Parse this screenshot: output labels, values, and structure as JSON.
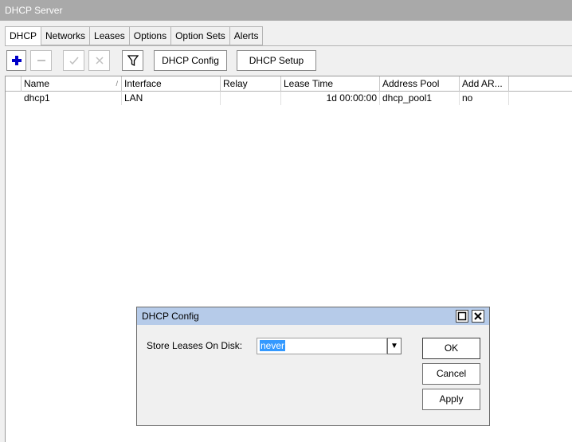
{
  "window": {
    "title": "DHCP Server"
  },
  "tabs": [
    {
      "label": "DHCP",
      "active": true
    },
    {
      "label": "Networks"
    },
    {
      "label": "Leases"
    },
    {
      "label": "Options"
    },
    {
      "label": "Option Sets"
    },
    {
      "label": "Alerts"
    }
  ],
  "toolbar": {
    "add_icon": "plus-icon",
    "remove_icon": "minus-icon",
    "enable_icon": "check-icon",
    "disable_icon": "cross-icon",
    "filter_icon": "filter-icon",
    "dhcp_config_label": "DHCP Config",
    "dhcp_setup_label": "DHCP Setup",
    "accent_color": "#0000c8"
  },
  "table": {
    "columns": [
      "Name",
      "Interface",
      "Relay",
      "Lease Time",
      "Address Pool",
      "Add AR..."
    ],
    "rows": [
      {
        "name": "dhcp1",
        "interface": "LAN",
        "relay": "",
        "lease_time": "1d 00:00:00",
        "address_pool": "dhcp_pool1",
        "add_arp": "no"
      }
    ]
  },
  "dialog": {
    "title": "DHCP Config",
    "field_label": "Store Leases On Disk:",
    "field_value": "never",
    "ok_label": "OK",
    "cancel_label": "Cancel",
    "apply_label": "Apply",
    "title_bar_color": "#b6cbe9"
  }
}
